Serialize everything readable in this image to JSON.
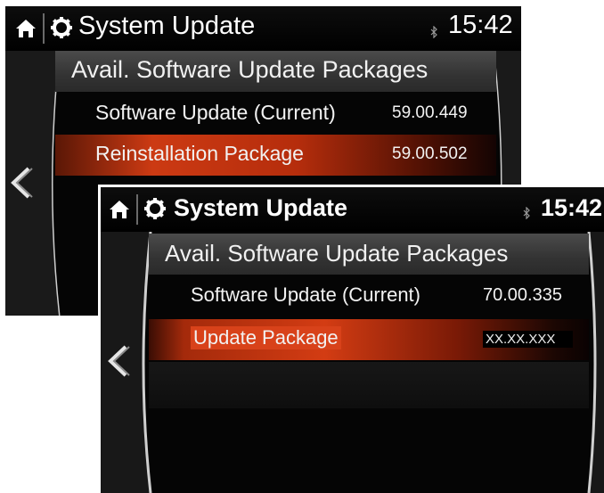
{
  "back_screen": {
    "title": "System Update",
    "time": "15:42",
    "list_header": "Avail. Software Update Packages",
    "rows": [
      {
        "name": "Software Update (Current)",
        "version": "59.00.449",
        "selected": false
      },
      {
        "name": "Reinstallation Package",
        "version": "59.00.502",
        "selected": true
      }
    ]
  },
  "front_screen": {
    "title": "System Update",
    "time": "15:42",
    "list_header": "Avail. Software Update Packages",
    "rows": [
      {
        "name": "Software Update (Current)",
        "version": "70.00.335",
        "selected": false
      },
      {
        "name": "Update Package",
        "version": "XX.XX.XXX",
        "selected": true
      }
    ]
  },
  "icons": {
    "home": "home-icon",
    "settings": "gear-icon",
    "bluetooth": "bluetooth-icon",
    "back": "back-chevron-icon"
  },
  "colors": {
    "highlight": "#cc3a13",
    "background": "#050505",
    "header_row": "#3a3a3a",
    "text": "#ffffff"
  }
}
